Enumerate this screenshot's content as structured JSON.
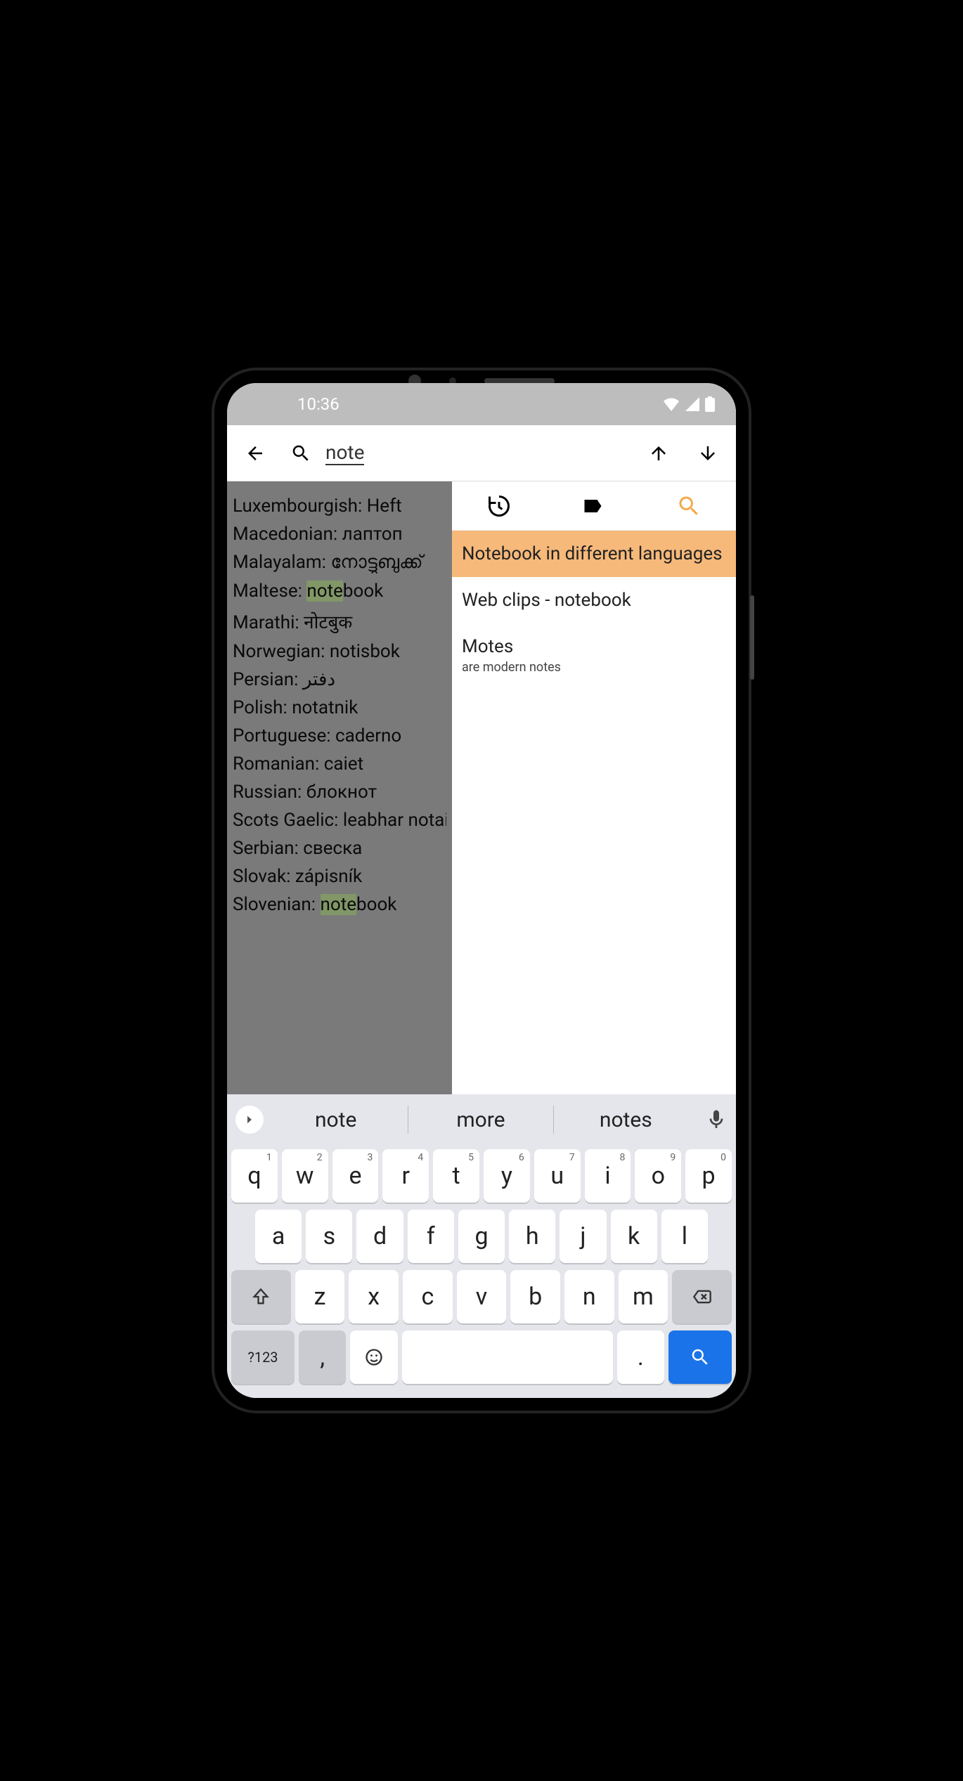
{
  "status": {
    "time": "10:36"
  },
  "search": {
    "query": "note"
  },
  "languages": [
    {
      "lang": "Luxembourgish",
      "word": "Heft",
      "hl": false
    },
    {
      "lang": "Macedonian",
      "word": "лаптоп",
      "hl": false
    },
    {
      "lang": "Malayalam",
      "word": "നോട്ടുബുക്ക്",
      "hl": false
    },
    {
      "lang": "Maltese",
      "word": "notebook",
      "hl": true,
      "hlPart": "note",
      "rest": "book"
    },
    {
      "lang": "Marathi",
      "word": "नोटबुक",
      "hl": false
    },
    {
      "lang": "Norwegian",
      "word": "notisbok",
      "hl": false
    },
    {
      "lang": "Persian",
      "word": "دفتر",
      "hl": false
    },
    {
      "lang": "Polish",
      "word": "notatnik",
      "hl": false
    },
    {
      "lang": "Portuguese",
      "word": "caderno",
      "hl": false
    },
    {
      "lang": "Romanian",
      "word": "caiet",
      "hl": false
    },
    {
      "lang": "Russian",
      "word": "блокнот",
      "hl": false
    },
    {
      "lang": "Scots Gaelic",
      "word": "leabhar notaichean",
      "hl": false
    },
    {
      "lang": "Serbian",
      "word": "свеска",
      "hl": false
    },
    {
      "lang": "Slovak",
      "word": "zápisník",
      "hl": false
    },
    {
      "lang": "Slovenian",
      "word": "notebook",
      "hl": true,
      "hlPart": "note",
      "rest": "book"
    }
  ],
  "results": [
    {
      "title": "Notebook in different languages",
      "active": true
    },
    {
      "title": "Web clips - notebook",
      "active": false
    },
    {
      "title": "Motes",
      "sub": "are modern notes",
      "active": false
    }
  ],
  "suggestions": [
    "note",
    "more",
    "notes"
  ],
  "keyboard": {
    "row1": [
      {
        "k": "q",
        "n": "1"
      },
      {
        "k": "w",
        "n": "2"
      },
      {
        "k": "e",
        "n": "3"
      },
      {
        "k": "r",
        "n": "4"
      },
      {
        "k": "t",
        "n": "5"
      },
      {
        "k": "y",
        "n": "6"
      },
      {
        "k": "u",
        "n": "7"
      },
      {
        "k": "i",
        "n": "8"
      },
      {
        "k": "o",
        "n": "9"
      },
      {
        "k": "p",
        "n": "0"
      }
    ],
    "row2": [
      "a",
      "s",
      "d",
      "f",
      "g",
      "h",
      "j",
      "k",
      "l"
    ],
    "row3": [
      "z",
      "x",
      "c",
      "v",
      "b",
      "n",
      "m"
    ],
    "symKey": "?123",
    "commaKey": ",",
    "periodKey": "."
  }
}
